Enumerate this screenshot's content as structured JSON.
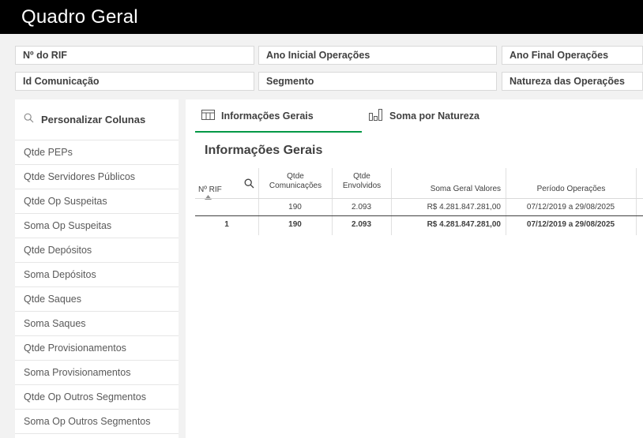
{
  "app": {
    "title": "Quadro Geral"
  },
  "filters": [
    {
      "label": "Nº do RIF"
    },
    {
      "label": "Ano Inicial Operações"
    },
    {
      "label": "Ano Final Operações"
    },
    {
      "label": "Id Comunicação"
    },
    {
      "label": "Segmento"
    },
    {
      "label": "Natureza das Operações"
    }
  ],
  "sidebar": {
    "header": {
      "label": "Personalizar Colunas",
      "icon": "search-icon"
    },
    "items": [
      {
        "label": "Qtde PEPs"
      },
      {
        "label": "Qtde Servidores Públicos"
      },
      {
        "label": "Qtde Op Suspeitas"
      },
      {
        "label": "Soma Op Suspeitas"
      },
      {
        "label": "Qtde Depósitos"
      },
      {
        "label": "Soma Depósitos"
      },
      {
        "label": "Qtde Saques"
      },
      {
        "label": "Soma Saques"
      },
      {
        "label": "Qtde Provisionamentos"
      },
      {
        "label": "Soma Provisionamentos"
      },
      {
        "label": "Qtde Op Outros Segmentos"
      },
      {
        "label": "Soma Op Outros Segmentos"
      }
    ]
  },
  "tabs": [
    {
      "label": "Informações Gerais",
      "icon": "table-icon",
      "active": true
    },
    {
      "label": "Soma por Natureza",
      "icon": "bar-chart-icon",
      "active": false
    }
  ],
  "section": {
    "title": "Informações Gerais"
  },
  "table": {
    "headers": {
      "rif": "Nº RIF",
      "comunicacoes_1": "Qtde",
      "comunicacoes_2": "Comunicações",
      "envolvidos_1": "Qtde",
      "envolvidos_2": "Envolvidos",
      "soma": "Soma Geral Valores",
      "periodo": "Período Operações"
    },
    "totals": {
      "rif": "",
      "comunicacoes": "190",
      "envolvidos": "2.093",
      "soma": "R$ 4.281.847.281,00",
      "periodo": "07/12/2019 a 29/08/2025"
    },
    "rows": [
      {
        "rif": "1",
        "comunicacoes": "190",
        "envolvidos": "2.093",
        "soma": "R$ 4.281.847.281,00",
        "periodo": "07/12/2019 a 29/08/2025"
      }
    ]
  }
}
